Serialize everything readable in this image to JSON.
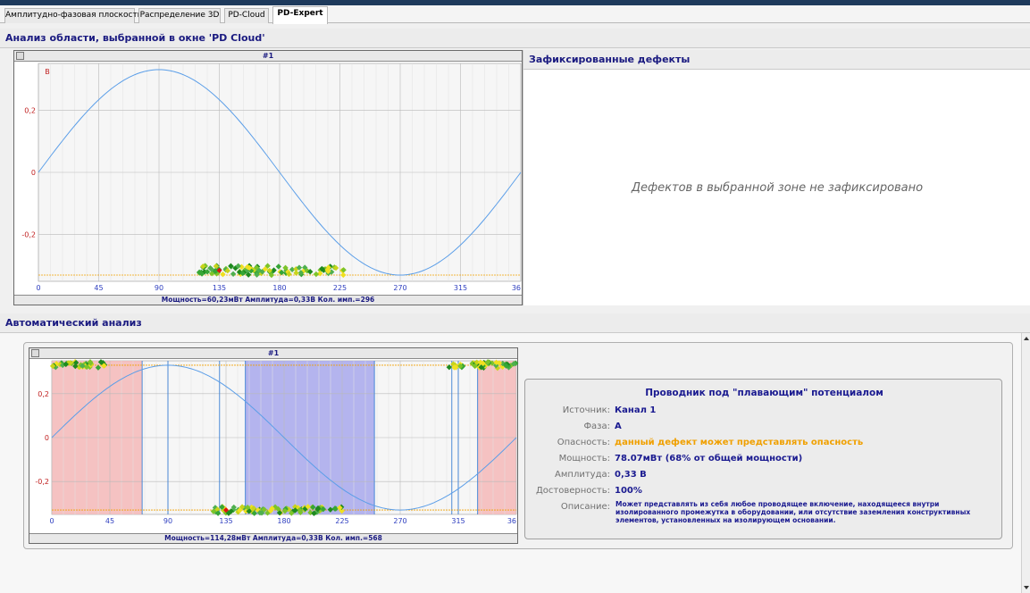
{
  "tabs": [
    {
      "label": "Амплитудно-фазовая плоскость",
      "active": false
    },
    {
      "label": "Распределение 3D",
      "active": false
    },
    {
      "label": "PD-Cloud",
      "active": false
    },
    {
      "label": "PD-Expert",
      "active": true
    }
  ],
  "cloud_section": {
    "title": "Анализ области, выбранной в окне 'PD Cloud'"
  },
  "chart1": {
    "title": "#1",
    "unit_label": "В",
    "footer": "Мощность=60,23мВт   Амплитуда=0,33В   Кол. имп.=296",
    "chart_data": {
      "type": "scatter",
      "xlim": [
        0,
        360
      ],
      "ylim": [
        -0.35,
        0.35
      ],
      "x_ticks": [
        "0",
        "45",
        "90",
        "135",
        "180",
        "225",
        "270",
        "315",
        "36"
      ],
      "y_ticks": [
        "0,2",
        "0",
        "-0,2"
      ],
      "threshold": -0.33,
      "sine_amplitude": 0.33,
      "points_x_range": [
        120,
        230
      ],
      "points_y": -0.315
    }
  },
  "defects": {
    "title": "Зафиксированные дефекты",
    "empty_message": "Дефектов в выбранной зоне не зафиксировано"
  },
  "auto_section": {
    "title": "Автоматический анализ"
  },
  "chart2": {
    "title": "#1",
    "footer": "Мощность=114,28мВт   Амплитуда=0,33В   Кол. имп.=568",
    "chart_data": {
      "type": "scatter",
      "xlim": [
        0,
        360
      ],
      "ylim": [
        -0.35,
        0.35
      ],
      "x_ticks": [
        "0",
        "45",
        "90",
        "135",
        "180",
        "225",
        "270",
        "315",
        "36"
      ],
      "y_ticks": [
        "0,2",
        "0",
        "-0,2"
      ],
      "red_zones": [
        [
          0,
          70
        ],
        [
          330,
          360
        ]
      ],
      "blue_zone": [
        150,
        250
      ],
      "vlines": [
        70,
        90,
        130,
        150,
        250,
        310,
        315,
        330
      ],
      "clusters": [
        {
          "x_range": [
            0,
            45
          ],
          "y": 0.33
        },
        {
          "x_range": [
            305,
            360
          ],
          "y": 0.33
        },
        {
          "x_range": [
            125,
            225
          ],
          "y": -0.33
        }
      ]
    }
  },
  "analysis": {
    "title": "Проводник под \"плавающим\" потенциалом",
    "rows": [
      {
        "label": "Источник:",
        "value": "Канал 1"
      },
      {
        "label": "Фаза:",
        "value": "A"
      },
      {
        "label": "Опасность:",
        "value": "данный дефект может представлять опасность"
      },
      {
        "label": "Мощность:",
        "value": "78.07мВт (68% от общей мощности)"
      },
      {
        "label": "Амплитуда:",
        "value": "0,33 В"
      },
      {
        "label": "Достоверность:",
        "value": "100%"
      }
    ],
    "description_label": "Описание:",
    "description": "Может представлять из себя любое проводящее включение, находящееся внутри изолированного промежутка в оборудовании, или отсутствие заземления конструктивных элементов, установленных на изолирующем основании."
  }
}
